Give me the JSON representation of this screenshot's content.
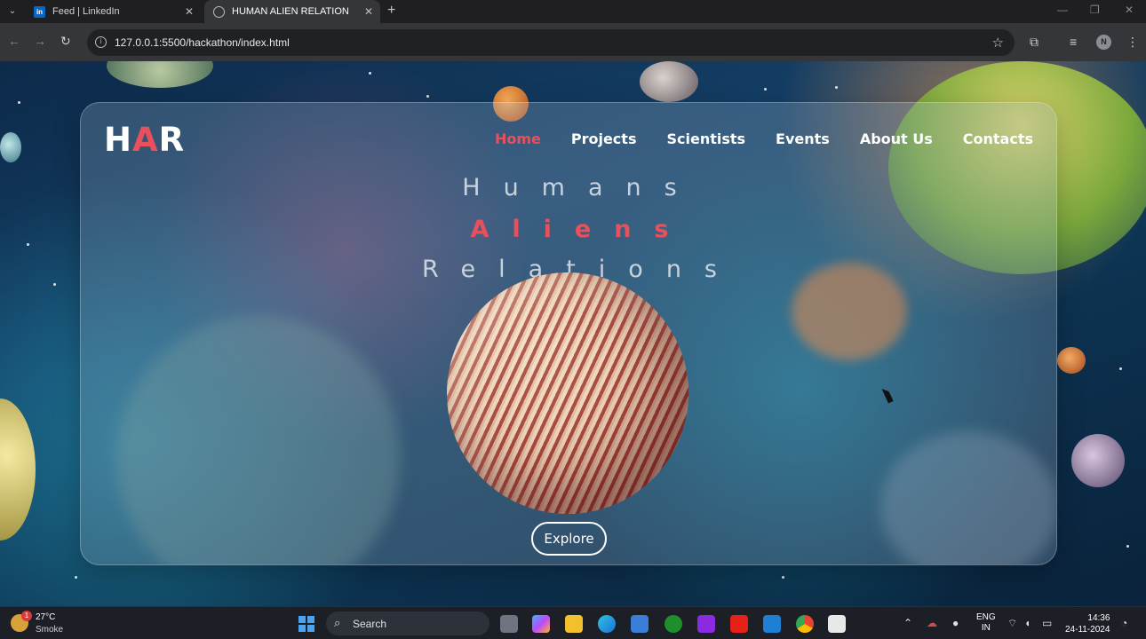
{
  "browser": {
    "tabs": [
      {
        "title": "Feed | LinkedIn",
        "icon": "linkedin-icon"
      },
      {
        "title": "HUMAN ALIEN RELATION",
        "icon": "globe-icon"
      }
    ],
    "close_glyph": "✕",
    "new_tab_glyph": "+",
    "url": "127.0.0.1:5500/hackathon/index.html",
    "profile_initial": "N"
  },
  "site": {
    "logo": {
      "part1": "H",
      "accent": "A",
      "part2": "R"
    },
    "nav": [
      "Home",
      "Projects",
      "Scientists",
      "Events",
      "About Us",
      "Contacts"
    ],
    "active_nav": "Home",
    "headline": [
      "Humans",
      "Aliens",
      "Relations"
    ],
    "cta": "Explore",
    "colors": {
      "accent": "#e8505b",
      "text": "#ffffff"
    }
  },
  "taskbar": {
    "weather_temp": "27°C",
    "weather_desc": "Smoke",
    "weather_badge": "1",
    "search_label": "Search",
    "lang_line1": "ENG",
    "lang_line2": "IN",
    "time": "14:36",
    "date": "24-11-2024"
  }
}
